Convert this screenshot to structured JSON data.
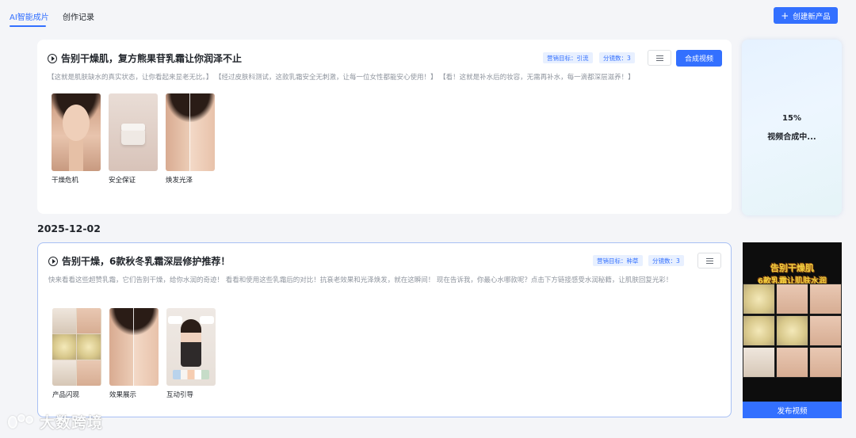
{
  "tabs": [
    {
      "label": "AI智能成片",
      "active": true
    },
    {
      "label": "创作记录",
      "active": false
    }
  ],
  "header": {
    "create_label": "创建新产品",
    "create_icon": "plus-icon"
  },
  "cards": [
    {
      "title": "告别干燥肌，复方熊果苷乳霜让你润泽不止",
      "tags": [
        "营销目标：引流",
        "分镜数：3"
      ],
      "synth_label": "合成视频",
      "script": "【这就是肌肤缺水的真实状态，让你看起来显老无比。】 【经过皮肤科测试，这款乳霜安全无刺激，让每一位女性都能安心使用！】 【看！这就是补水后的妆容，无需再补水，每一滴都深层滋养！】",
      "shots": [
        "干燥危机",
        "安全保证",
        "焕发光泽"
      ]
    },
    {
      "title": "告别干燥，6款秋冬乳霜深层修护推荐！",
      "tags": [
        "营销目标：种草",
        "分镜数：3"
      ],
      "script": "快来看看这些超赞乳霜，它们告别干燥，给你水润的奇迹！ 看看和使用这些乳霜后的对比！抗衰老效果和光泽焕发，就在这瞬间！ 现在告诉我，你最心水哪款呢？点击下方链接感受水润秘籍，让肌肤回复光彩！",
      "shots": [
        "产品闪现",
        "效果展示",
        "互动引导"
      ]
    }
  ],
  "date_group": "2025-12-02",
  "progress": {
    "percent": "15%",
    "status": "视频合成中..."
  },
  "video": {
    "title_line1": "告别干燥肌",
    "title_line2": "6款乳霜让肌肤水润",
    "publish_label": "发布视频"
  },
  "watermark": {
    "text": "大数跨境"
  },
  "colors": {
    "accent": "#3370ff",
    "tag_bg": "#e8f0ff",
    "video_title": "#f4d03f"
  }
}
